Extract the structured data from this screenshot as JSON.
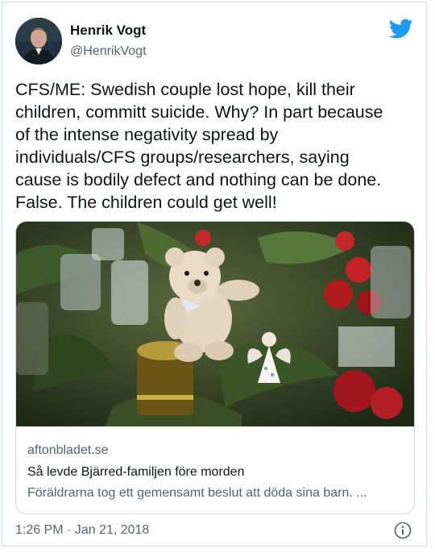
{
  "author": {
    "name": "Henrik Vogt",
    "handle": "@HenrikVogt"
  },
  "icons": {
    "brand": "twitter-bird-icon",
    "info": "info-icon"
  },
  "colors": {
    "brand": "#1d9bf0",
    "text": "#0f1419",
    "secondary": "#536471",
    "border": "#cfd9de"
  },
  "tweet": {
    "text": "CFS/ME: Swedish couple lost hope, kill their\nchildren, committ suicide. Why? In part because\nof the intense negativity spread by\nindividuals/CFS groups/researchers, saying\ncause is bodily defect and nothing can be done.\nFalse. The children could get well!",
    "timestamp": "1:26 PM · Jan 21, 2018"
  },
  "card": {
    "domain": "aftonbladet.se",
    "title": "Så levde Bjärred-familjen före morden",
    "description": "Föräldrarna tog ett gemensamt beslut att döda sina barn. ..."
  }
}
